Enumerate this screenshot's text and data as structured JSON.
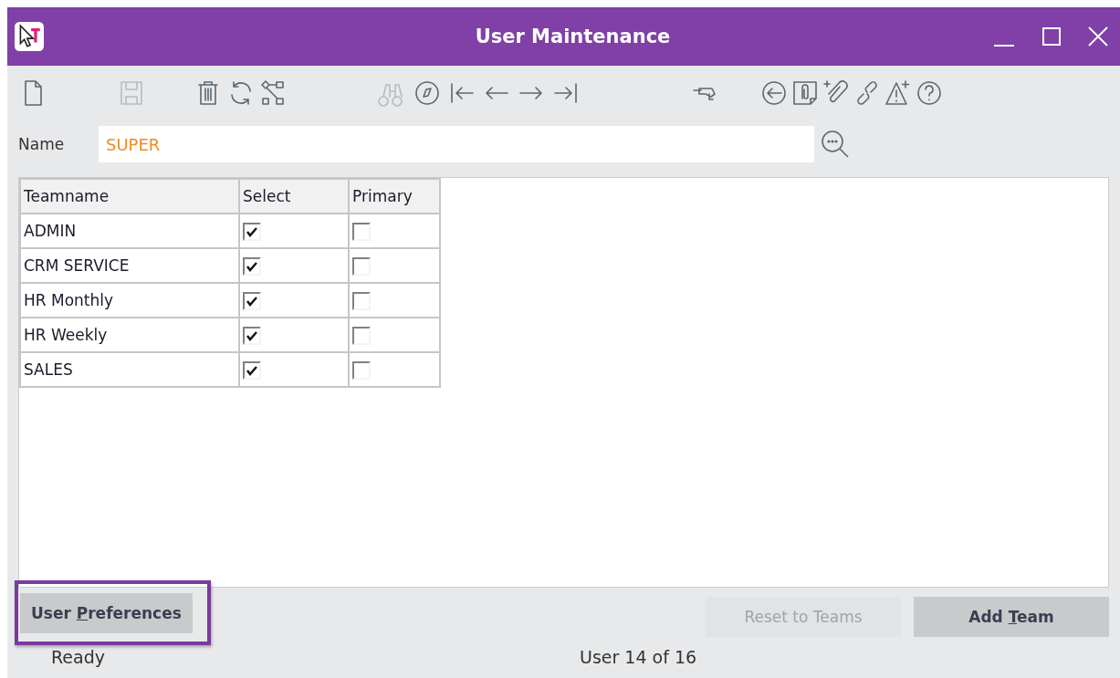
{
  "window": {
    "title": "User Maintenance"
  },
  "toolbar": [
    {
      "kind": "new",
      "disabled": false
    },
    {
      "kind": "save",
      "disabled": true
    },
    {
      "kind": "delete",
      "disabled": false
    },
    {
      "kind": "refresh",
      "disabled": false
    },
    {
      "kind": "workflow",
      "disabled": false
    },
    {
      "kind": "find",
      "disabled": true
    },
    {
      "kind": "compass",
      "disabled": false
    },
    {
      "kind": "first",
      "disabled": false
    },
    {
      "kind": "prev",
      "disabled": false
    },
    {
      "kind": "next",
      "disabled": false
    },
    {
      "kind": "last",
      "disabled": false
    },
    {
      "kind": "scanner",
      "disabled": false
    },
    {
      "kind": "back",
      "disabled": false
    },
    {
      "kind": "attachment",
      "disabled": false
    },
    {
      "kind": "add-attachment",
      "disabled": false
    },
    {
      "kind": "link",
      "disabled": false
    },
    {
      "kind": "add-alert",
      "disabled": false
    },
    {
      "kind": "help",
      "disabled": false
    }
  ],
  "name_field": {
    "label": "Name",
    "value": "SUPER"
  },
  "table": {
    "columns": [
      "Teamname",
      "Select",
      "Primary"
    ],
    "rows": [
      {
        "team": "ADMIN",
        "select": true,
        "primary": false
      },
      {
        "team": "CRM SERVICE",
        "select": true,
        "primary": false
      },
      {
        "team": "HR Monthly",
        "select": true,
        "primary": false
      },
      {
        "team": "HR Weekly",
        "select": true,
        "primary": false
      },
      {
        "team": "SALES",
        "select": true,
        "primary": false
      }
    ]
  },
  "buttons": [
    {
      "kind": "left",
      "label_parts": [
        "User ",
        "P",
        "references"
      ],
      "disabled": false,
      "highlighted": true
    },
    {
      "kind": "right",
      "label_parts": [
        "Reset to Teams"
      ],
      "disabled": true,
      "highlighted": false
    },
    {
      "kind": "right",
      "label_parts": [
        "Add ",
        "T",
        "eam"
      ],
      "disabled": false,
      "highlighted": false
    }
  ],
  "status_bar": {
    "state": "Ready",
    "record": "User 14 of 16"
  }
}
